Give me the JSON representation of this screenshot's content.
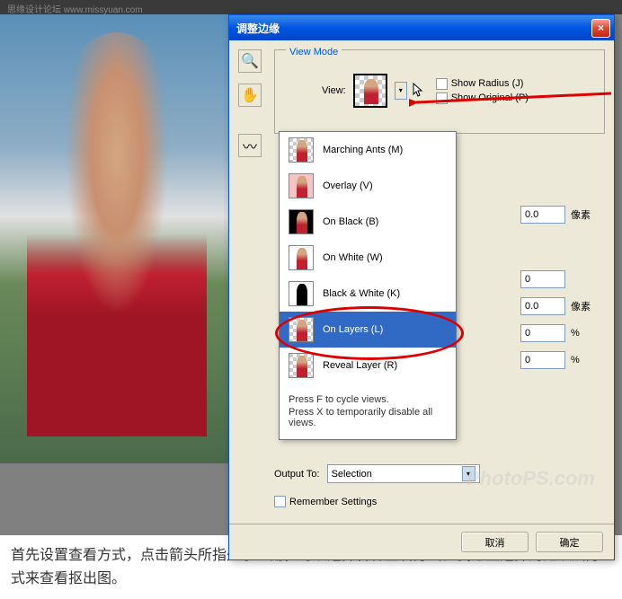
{
  "topbar": {
    "text": "思缘设计论坛 www.missyuan.com"
  },
  "dialog": {
    "title": "调整边缘",
    "close": "×",
    "view_mode_legend": "View Mode",
    "view_label": "View:",
    "show_radius": "Show Radius (J)",
    "show_original": "Show Original (P)",
    "menu": [
      {
        "label": "Marching Ants (M)",
        "cls": "thumb-checker thumb-fig"
      },
      {
        "label": "Overlay (V)",
        "cls": "thumb-pink thumb-fig"
      },
      {
        "label": "On Black (B)",
        "cls": "thumb-black thumb-fig"
      },
      {
        "label": "On White (W)",
        "cls": "thumb-white thumb-fig"
      },
      {
        "label": "Black & White (K)",
        "cls": "thumb-bw"
      },
      {
        "label": "On Layers (L)",
        "cls": "thumb-checker thumb-fig",
        "selected": true
      },
      {
        "label": "Reveal Layer (R)",
        "cls": "thumb-checker thumb-fig"
      }
    ],
    "footer1": "Press F to cycle views.",
    "footer2": "Press X to temporarily disable all views.",
    "inputs": {
      "r1": {
        "val": "0.0",
        "unit": "像素"
      },
      "r2": {
        "val": "0",
        "unit": ""
      },
      "r3": {
        "val": "0.0",
        "unit": "像素"
      },
      "r4": {
        "val": "0",
        "unit": "%"
      },
      "r5": {
        "val": "0",
        "unit": "%"
      }
    },
    "output_label": "Output To:",
    "output_value": "Selection",
    "remember": "Remember Settings",
    "cancel": "取消",
    "ok": "确定"
  },
  "caption": "首先设置查看方式，点击箭头所指处小三角，可以选择各种查看方式。我这里选择的是以层方式来查看抠出图。",
  "watermark": "PhotoPS.com"
}
